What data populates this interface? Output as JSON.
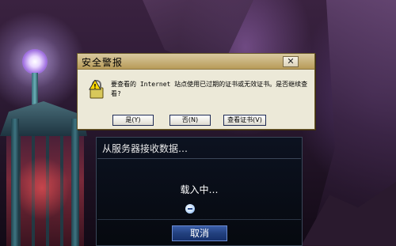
{
  "alert_dialog": {
    "title": "安全警报",
    "close_label": "✕",
    "message": "要查看的 Internet 站点使用已过期的证书或无效证书。是否继续查看?",
    "buttons": {
      "yes": "是(Y)",
      "no": "否(N)",
      "view_cert": "查看证书(V)"
    },
    "icon": "security-warning-icon"
  },
  "loading_panel": {
    "title": "从服务器接收数据…",
    "status": "载入中…",
    "spinner_icon": "loading-spinner-icon",
    "cancel_label": "取消"
  },
  "colors": {
    "dialog_bg": "#ece9d8",
    "dialog_titlebar": "#c8b27c",
    "panel_bg": "#0c1220",
    "cancel_button": "#22407e"
  }
}
